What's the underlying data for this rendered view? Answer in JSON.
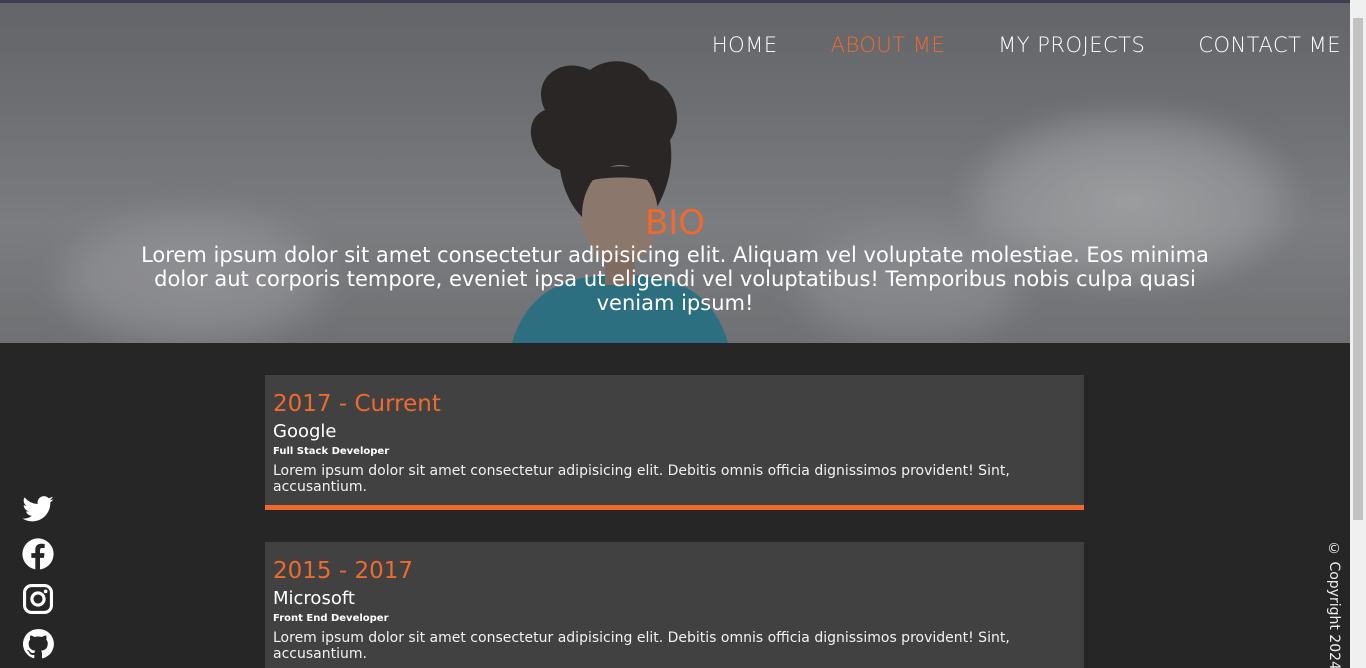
{
  "nav": {
    "items": [
      {
        "label": "HOME",
        "active": false
      },
      {
        "label": "ABOUT ME",
        "active": true
      },
      {
        "label": "MY PROJECTS",
        "active": false
      },
      {
        "label": "CONTACT ME",
        "active": false
      }
    ]
  },
  "bio": {
    "title": "BIO",
    "text": "Lorem ipsum dolor sit amet consectetur adipisicing elit. Aliquam vel voluptate molestiae. Eos minima dolor aut corporis tempore, eveniet ipsa ut eligendi vel voluptatibus! Temporibus nobis culpa quasi veniam ipsum!"
  },
  "experience": [
    {
      "years": "2017 - Current",
      "company": "Google",
      "role": "Full Stack Developer",
      "description": "Lorem ipsum dolor sit amet consectetur adipisicing elit. Debitis omnis officia dignissimos provident! Sint, accusantium."
    },
    {
      "years": "2015 - 2017",
      "company": "Microsoft",
      "role": "Front End Developer",
      "description": "Lorem ipsum dolor sit amet consectetur adipisicing elit. Debitis omnis officia dignissimos provident! Sint, accusantium."
    }
  ],
  "social": [
    "twitter-icon",
    "facebook-icon",
    "instagram-icon",
    "github-icon"
  ],
  "footer": {
    "copyright": "© Copyright 2024"
  },
  "colors": {
    "accent": "#f06a2e",
    "background": "#262626",
    "card": "#414141"
  }
}
